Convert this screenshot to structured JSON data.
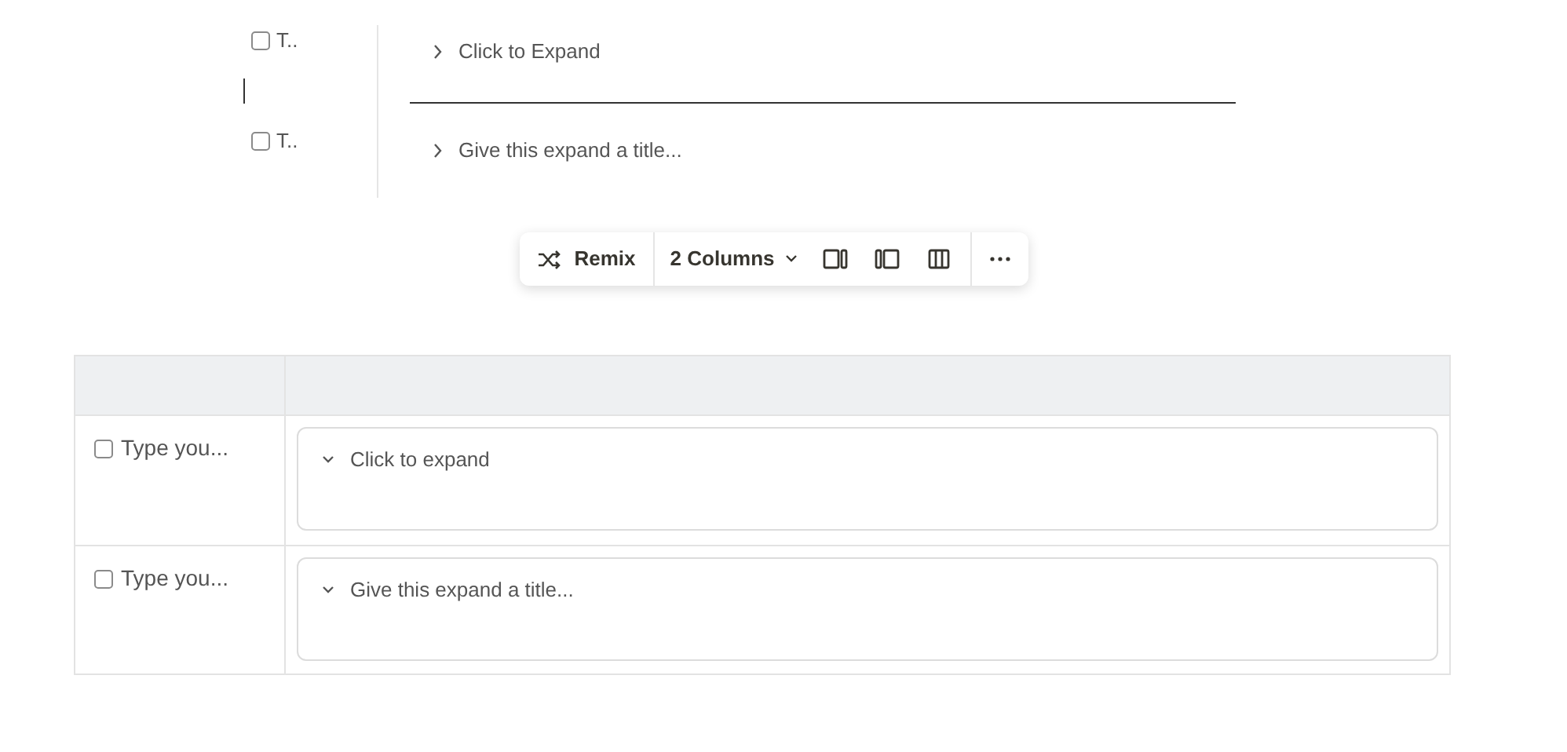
{
  "columns_block": {
    "checklist": [
      {
        "text": "T..",
        "checked": false
      },
      {
        "text": "T..",
        "checked": false
      }
    ],
    "expands": [
      {
        "title": "Click to Expand",
        "expanded": false
      },
      {
        "title": "Give this expand a title...",
        "expanded": false
      }
    ]
  },
  "toolbar": {
    "remix": "Remix",
    "layout": "2 Columns"
  },
  "table": {
    "rows": [
      {
        "task": {
          "text": "Type you...",
          "checked": false
        },
        "expand": {
          "title": "Click to expand",
          "expanded": true
        }
      },
      {
        "task": {
          "text": "Type you...",
          "checked": false
        },
        "expand": {
          "title": "Give this expand a title...",
          "expanded": true
        }
      }
    ]
  }
}
